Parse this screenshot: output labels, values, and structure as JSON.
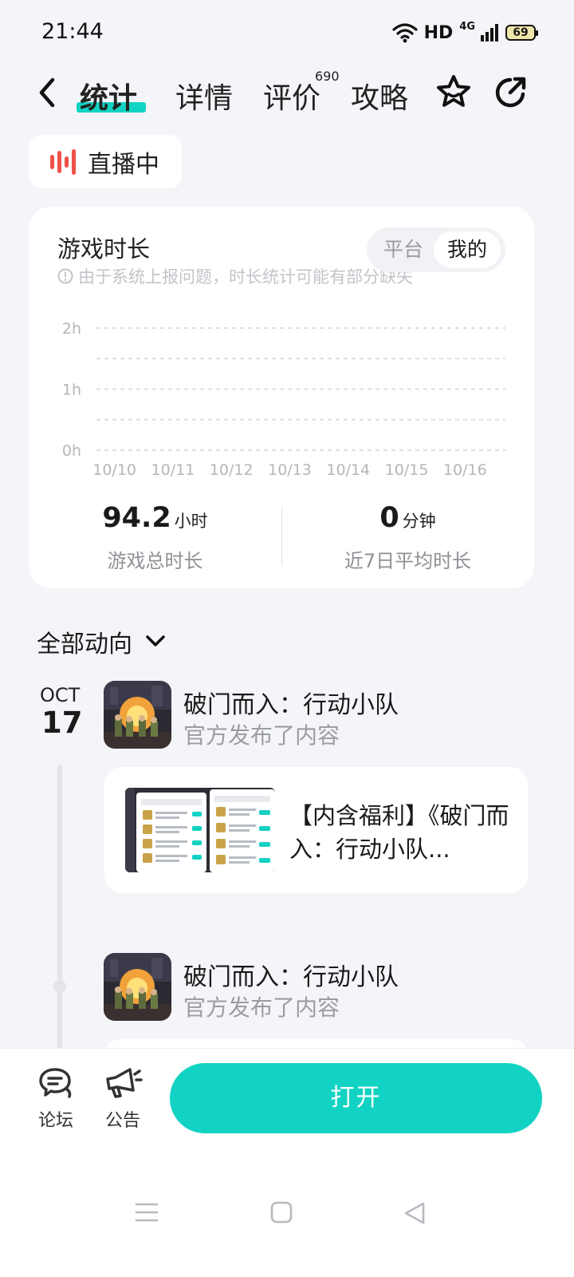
{
  "status_bar": {
    "time": "21:44",
    "network": "HD",
    "cell": "4G",
    "battery": "69"
  },
  "nav": {
    "tabs": [
      {
        "label": "统计",
        "active": true
      },
      {
        "label": "详情"
      },
      {
        "label": "评价",
        "badge": "690"
      },
      {
        "label": "攻略"
      }
    ]
  },
  "live": {
    "label": "直播中"
  },
  "stats": {
    "title": "游戏时长",
    "note": "由于系统上报问题，时长统计可能有部分缺失",
    "toggle": {
      "options": [
        "平台",
        "我的"
      ],
      "selected": "我的"
    },
    "total": {
      "value": "94.2",
      "unit": "小时",
      "label": "游戏总时长"
    },
    "average": {
      "value": "0",
      "unit": "分钟",
      "label": "近7日平均时长"
    }
  },
  "chart_data": {
    "type": "bar",
    "categories": [
      "10/10",
      "10/11",
      "10/12",
      "10/13",
      "10/14",
      "10/15",
      "10/16"
    ],
    "values": [
      0,
      0,
      0,
      0,
      0,
      0,
      0
    ],
    "yticks": [
      "0h",
      "1h",
      "2h"
    ],
    "ylim": [
      0,
      2
    ],
    "grid": true
  },
  "feed": {
    "filter_label": "全部动向",
    "date": {
      "month": "OCT",
      "day": "17"
    },
    "items": [
      {
        "game": "破门而入：行动小队",
        "action": "官方发布了内容",
        "card_text": "【内含福利】《破门而入：行动小队..."
      },
      {
        "game": "破门而入：行动小队",
        "action": "官方发布了内容"
      }
    ]
  },
  "bottom": {
    "forum_label": "论坛",
    "notice_label": "公告",
    "open_label": "打开"
  },
  "colors": {
    "accent": "#12d3c3",
    "live_red": "#f0504a"
  }
}
